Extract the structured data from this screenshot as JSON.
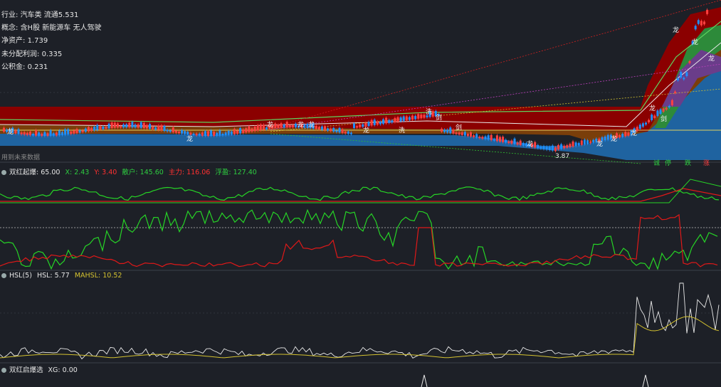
{
  "stock_info": {
    "industry_label": "行业:",
    "industry_value": "汽车类",
    "float_label": "流通",
    "float_value": "5.531",
    "concept_label": "概念:",
    "concept_value": "含H股 新能源车 无人驾驶",
    "net_asset_label": "净资产:",
    "net_asset_value": "1.739",
    "undist_profit_label": "未分配利润:",
    "undist_profit_value": "0.335",
    "reserve_label": "公积金:",
    "reserve_value": "0.231"
  },
  "main_chart": {
    "future_data_note": "用到未来数据",
    "low_price_label": "3.87",
    "markers": [
      "龙",
      "龙",
      "龙",
      "龙",
      "龙",
      "龙",
      "洗",
      "洗",
      "剑",
      "剑",
      "龙",
      "龙",
      "龙",
      "龙",
      "龙",
      "剑",
      "龙"
    ],
    "right_buttons": [
      "诚",
      "停",
      "跌",
      "涨"
    ]
  },
  "indicator1": {
    "name": "双红起爆",
    "param": ": 65.00",
    "x_label": "X: 2.43",
    "y_label": "Y: 3.40",
    "sanhu_label": "散户: 145.60",
    "zhuli_label": "主力: 116.06",
    "fuying_label": "浮盈: 127.40",
    "colors": {
      "x": "#2ecc40",
      "y": "#ff3030",
      "sanhu": "#2ecc40",
      "zhuli": "#ff3030",
      "fuying": "#2ecc40"
    }
  },
  "indicator2": {
    "name": "HSL(5)",
    "hsl_label": "HSL: 5.77",
    "mahsl_label": "MAHSL: 10.52"
  },
  "indicator3": {
    "name": "双红启爆选",
    "xg_label": "XG: 0.00"
  },
  "colors": {
    "background": "#1d2027",
    "up": "#ff4040",
    "down": "#1e90ff",
    "green_line": "#26d426",
    "red_line": "#e01818",
    "white_line": "#e8e8e8",
    "yellow_line": "#d4c230"
  }
}
